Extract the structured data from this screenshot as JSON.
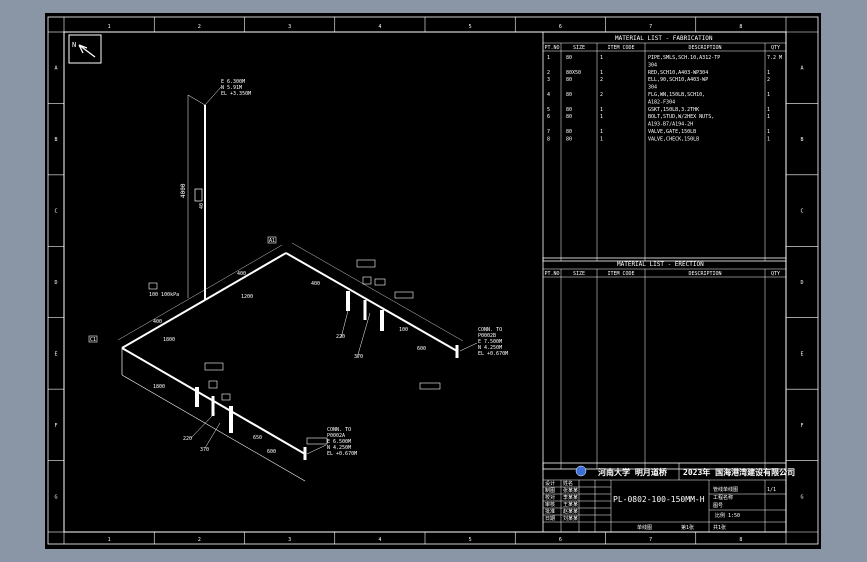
{
  "frame": {
    "top_cols": [
      "1",
      "2",
      "3",
      "4",
      "5",
      "6",
      "7",
      "8"
    ],
    "side_rows": [
      "A",
      "B",
      "C",
      "D",
      "E",
      "F",
      "G"
    ],
    "north_label": "N"
  },
  "fabrication": {
    "title": "MATERIAL  LIST  -  FABRICATION",
    "headers": [
      "PT.NO",
      "SIZE",
      "ITEM CODE",
      "DESCRIPTION",
      "QTY"
    ],
    "rows": [
      [
        "1",
        "80",
        "1",
        "PIPE,SMLS,SCH.10,A312-TP",
        "7.2 M"
      ],
      [
        "",
        "",
        "",
        "304",
        "",
        ""
      ],
      [
        "2",
        "80X50",
        "1",
        "RED,SCH10,A403-WP304",
        "1"
      ],
      [
        "3",
        "80",
        "2",
        "ELL,90,SCH10,A403-WP",
        "2"
      ],
      [
        "",
        "",
        "",
        "304",
        "",
        ""
      ],
      [
        "4",
        "80",
        "2",
        "FLG,WN,150LB,SCH10,",
        "1"
      ],
      [
        "",
        "",
        "",
        "A182-F304",
        "",
        ""
      ],
      [
        "5",
        "80",
        "1",
        "GSKT,150LB,3.2THK",
        "1"
      ],
      [
        "6",
        "80",
        "1",
        "BOLT,STUD,W/2HEX NUTS,",
        "1"
      ],
      [
        "",
        "",
        "",
        "A193-B7/A194-2H",
        "",
        ""
      ],
      [
        "7",
        "80",
        "1",
        "VALVE,GATE,150LB",
        "1"
      ],
      [
        "8",
        "80",
        "1",
        "VALVE,CHECK,150LB",
        "1"
      ]
    ]
  },
  "erection": {
    "title": "MATERIAL  LIST  -  ERECTION",
    "headers": [
      "PT.NO",
      "SIZE",
      "ITEM CODE",
      "DESCRIPTION",
      "QTY"
    ]
  },
  "drawing": {
    "top_point": [
      "E 6.300M",
      "N 5.91M",
      "EL +3.350M"
    ],
    "vertical_dim": "4000",
    "vert_tag": "40",
    "elbow_tag": "100 100kPa",
    "left_end_tag": "C1",
    "corner_label": "A1",
    "dims": {
      "upper_run": "1200",
      "upper_small": "400",
      "left_run": "1800",
      "lower_run": "1800",
      "lower_small": "650",
      "right_run": "600",
      "right_small": "100"
    },
    "angle_labels": [
      "220",
      "370",
      "220",
      "370"
    ],
    "conn_upper": [
      "CONN. TO",
      "P0002B",
      "E 7.500M",
      "N 4.250M",
      "EL +0.670M"
    ],
    "conn_lower": [
      "CONN. TO",
      "P0002A",
      "E 6.500M",
      "N 4.250M",
      "EL +0.670M"
    ],
    "tag_labels": [
      "40",
      "A1",
      "B",
      "2",
      "C",
      "50",
      "C1"
    ]
  },
  "title_block": {
    "school": "河南大学 明月道桥",
    "year_company": "2023年 国海港湾建设有限公司",
    "drawing_no": "PL-0802-100-150MM-H",
    "row_labels": [
      "设计",
      "制图",
      "校对",
      "审核",
      "批准",
      "日期"
    ],
    "row_names": [
      "姓名",
      "张某某",
      "李某某",
      "王某某",
      "赵某某",
      "刘某某"
    ],
    "project": "管线单线图",
    "sub1": "工程名称",
    "sub2": "图号",
    "sheet_note": "比例 1:50",
    "right_note": "1/1",
    "footer": [
      "单线图",
      "第1张",
      "共1张"
    ]
  }
}
